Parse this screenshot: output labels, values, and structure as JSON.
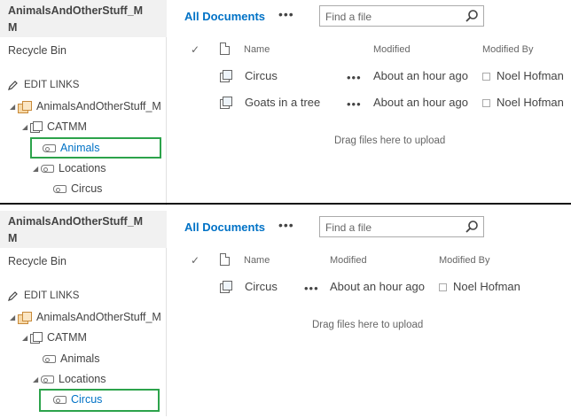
{
  "panels": [
    {
      "site_title": "AnimalsAndOtherStuff_MM",
      "recycle_bin": "Recycle Bin",
      "edit_links": "EDIT LINKS",
      "tree": {
        "site": "AnimalsAndOtherStuff_M",
        "library": "CATMM",
        "animals": "Animals",
        "locations": "Locations",
        "circus": "Circus"
      },
      "selected": "Animals",
      "view_title": "All Documents",
      "view_more": "•••",
      "search_placeholder": "Find a file",
      "columns": {
        "name": "Name",
        "modified": "Modified",
        "modified_by": "Modified By"
      },
      "rows": [
        {
          "name": "Circus",
          "dots": "•••",
          "modified": "About an hour ago",
          "modified_by": "Noel Hofman"
        },
        {
          "name": "Goats in a tree",
          "dots": "•••",
          "modified": "About an hour ago",
          "modified_by": "Noel Hofman"
        }
      ],
      "drag_text": "Drag files here to upload"
    },
    {
      "site_title": "AnimalsAndOtherStuff_MM",
      "recycle_bin": "Recycle Bin",
      "edit_links": "EDIT LINKS",
      "tree": {
        "site": "AnimalsAndOtherStuff_M",
        "library": "CATMM",
        "animals": "Animals",
        "locations": "Locations",
        "circus": "Circus"
      },
      "selected": "Circus",
      "view_title": "All Documents",
      "view_more": "•••",
      "search_placeholder": "Find a file",
      "columns": {
        "name": "Name",
        "modified": "Modified",
        "modified_by": "Modified By"
      },
      "rows": [
        {
          "name": "Circus",
          "dots": "•••",
          "modified": "About an hour ago",
          "modified_by": "Noel Hofman"
        }
      ],
      "drag_text": "Drag files here to upload"
    }
  ],
  "colors": {
    "accent": "#0072c6",
    "highlight": "#2ca34b",
    "title_bg": "#f1f1f1"
  }
}
